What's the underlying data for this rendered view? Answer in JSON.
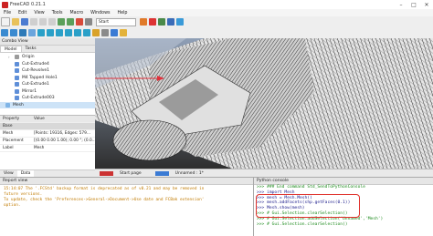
{
  "window": {
    "title": "FreeCAD 0.21.1"
  },
  "menu": [
    "File",
    "Edit",
    "View",
    "Tools",
    "Macro",
    "Windows",
    "Help"
  ],
  "toolbar": {
    "workbench": "Start"
  },
  "combo_view": {
    "title": "Combo View",
    "tabs": [
      "Model",
      "Tasks"
    ],
    "tree": [
      {
        "label": "Origin",
        "icon": "origin-icon"
      },
      {
        "label": "Cut-Extrude4",
        "icon": "cut-icon"
      },
      {
        "label": "Cut-Revolve1",
        "icon": "cut-icon"
      },
      {
        "label": "M4 Tapped Hole1",
        "icon": "hole-icon"
      },
      {
        "label": "Cut-Extrude1",
        "icon": "cut-icon"
      },
      {
        "label": "Mirror1",
        "icon": "mirror-icon"
      },
      {
        "label": "Cut-Extrude003",
        "icon": "cut-icon"
      },
      {
        "label": "Mesh",
        "icon": "mesh-icon"
      }
    ],
    "selected": "Mesh"
  },
  "properties": {
    "columns": [
      "Property",
      "Value"
    ],
    "group": "Base",
    "rows": [
      {
        "name": "Mesh",
        "value": "[Points: 19316, Edges: 579..."
      },
      {
        "name": "Placement",
        "value": "[(0.00 0.00 1.00); 0.00 °; (0.0..."
      },
      {
        "name": "Label",
        "value": "Mesh"
      }
    ]
  },
  "bottom_tabs": [
    "View",
    "Data"
  ],
  "view_tabs": [
    "Start page",
    "Unnamed : 1*"
  ],
  "report_view": {
    "title": "Report view",
    "lines": [
      "15:14:07  The '.FCStd' backup format is deprecated as of v0.21 and may be removed in",
      "future versions.",
      "To update, check the 'Preferences->General->Document->Use date and FCBak extension'",
      "option."
    ]
  },
  "python_console": {
    "title": "Python console",
    "lines": [
      {
        "text": ">>> ### End command Std_SendToPythonConsole",
        "kind": "cmt"
      },
      {
        "text": ">>> import Mesh",
        "kind": "code"
      },
      {
        "text": ">>> mesh = Mesh.Mesh()",
        "kind": "code"
      },
      {
        "text": ">>> mesh.addFacets(shp.getFaces(0.1))",
        "kind": "code"
      },
      {
        "text": ">>> Mesh.show(mesh)",
        "kind": "code"
      },
      {
        "text": ">>> # Gui.Selection.clearSelection()",
        "kind": "cmt"
      },
      {
        "text": ">>> # Gui.Selection.addSelection('Unnamed','Mesh')",
        "kind": "cmt"
      },
      {
        "text": ">>> # Gui.Selection.clearSelection()",
        "kind": "cmt"
      }
    ]
  }
}
